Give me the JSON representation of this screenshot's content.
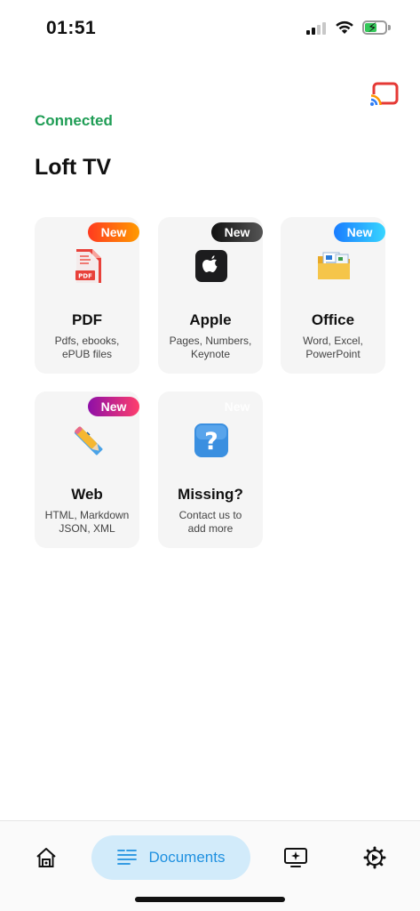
{
  "status_bar": {
    "time": "01:51"
  },
  "header": {
    "connection_status": "Connected",
    "device_name": "Loft TV"
  },
  "categories": [
    {
      "badge": "New",
      "title": "PDF",
      "subtitle_lines": [
        "Pdfs, ebooks,",
        "ePUB files"
      ],
      "icon": "pdf-file-icon"
    },
    {
      "badge": "New",
      "title": "Apple",
      "subtitle_lines": [
        "Pages, Numbers,",
        "Keynote"
      ],
      "icon": "apple-logo-icon"
    },
    {
      "badge": "New",
      "title": "Office",
      "subtitle_lines": [
        "Word, Excel,",
        "PowerPoint"
      ],
      "icon": "folder-documents-icon"
    },
    {
      "badge": "New",
      "title": "Web",
      "subtitle_lines": [
        "HTML, Markdown",
        "JSON, XML"
      ],
      "icon": "pencil-ruler-icon"
    },
    {
      "badge": "New",
      "title": "Missing?",
      "subtitle_lines": [
        "Contact us to",
        "add more"
      ],
      "icon": "question-mark-icon"
    }
  ],
  "tab_bar": {
    "documents_label": "Documents",
    "active": "documents"
  },
  "colors": {
    "connected": "#1f9d55",
    "accent": "#1e90e0",
    "active_tab_bg": "#d2ebfa",
    "cast_icon": "#e53935"
  }
}
